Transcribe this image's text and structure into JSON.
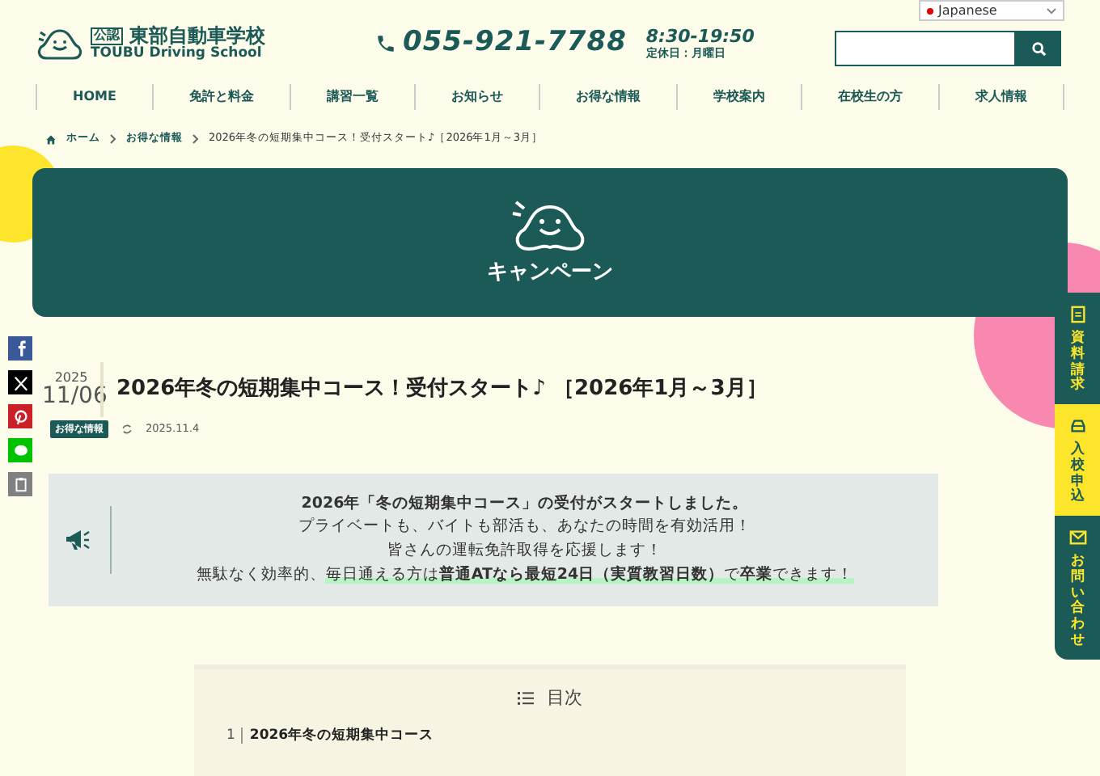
{
  "language_selector": {
    "value": "Japanese"
  },
  "header": {
    "logo_badge": "公認",
    "logo_name": "東部自動車学校",
    "logo_sub": "TOUBU Driving School",
    "phone": "055-921-7788",
    "hours": "8:30-19:50",
    "closed": "定休日：月曜日"
  },
  "nav": [
    "HOME",
    "免許と料金",
    "講習一覧",
    "お知らせ",
    "お得な情報",
    "学校案内",
    "在校生の方",
    "求人情報"
  ],
  "breadcrumb": [
    "ホーム",
    "お得な情報",
    "2026年冬の短期集中コース！受付スタート♪［2026年1月～3月］"
  ],
  "banner": {
    "title": "キャンペーン"
  },
  "share_buttons": [
    {
      "kind": "facebook",
      "color": "#3b5998"
    },
    {
      "kind": "x",
      "color": "#000000"
    },
    {
      "kind": "pinterest",
      "color": "#cb2027"
    },
    {
      "kind": "line",
      "color": "#00c300"
    },
    {
      "kind": "copy",
      "color": "#808080"
    }
  ],
  "post": {
    "year": "2025",
    "date": "11/06",
    "title": "2026年冬の短期集中コース！受付スタート♪ ［2026年1月～3月］",
    "category": "お得な情報",
    "updated": "2025.11.4"
  },
  "notice": {
    "lines": [
      {
        "bold": true,
        "segments": [
          {
            "text": "2026年「冬の短期集中コース」の受付がスタートしました。",
            "highlight": false
          }
        ]
      },
      {
        "bold": false,
        "segments": [
          {
            "text": "プライベートも、バイトも部活も、あなたの時間を有効活用！",
            "highlight": false
          }
        ]
      },
      {
        "bold": false,
        "segments": [
          {
            "text": "皆さんの運転免許取得を応援します！",
            "highlight": false
          }
        ]
      },
      {
        "bold": false,
        "segments": [
          {
            "text": "無駄なく効率的、",
            "highlight": false
          },
          {
            "text": "毎日通える方は**普通ATなら最短24日（実質教習日数）**で**卒業**できます！",
            "highlight": true
          }
        ]
      }
    ]
  },
  "toc": {
    "title": "目次",
    "items": [
      {
        "number": "1",
        "text": "2026年冬の短期集中コース"
      }
    ]
  },
  "side_tabs": [
    {
      "kind": "document",
      "label": "資料請求",
      "color": "#1b5a57"
    },
    {
      "kind": "car",
      "label": "入校申込",
      "color": "#fce52a"
    },
    {
      "kind": "mail",
      "label": "お問い合わせ",
      "color": "#1b5a57"
    }
  ]
}
